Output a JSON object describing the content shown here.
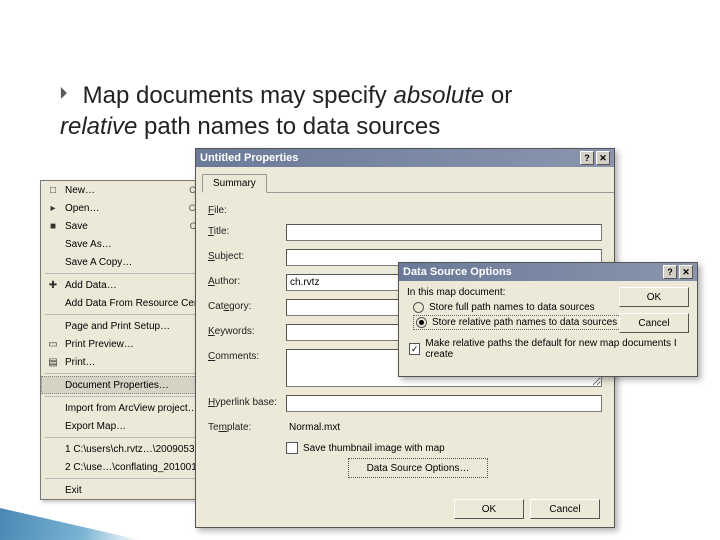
{
  "heading": {
    "pre": "Map documents may specify ",
    "em1": "absolute",
    "mid": " or ",
    "em2": "relative",
    "post": " path names to data sources"
  },
  "filemenu": {
    "items": [
      {
        "icon": "□",
        "label": "New…",
        "shortcut": "Ctrl+N"
      },
      {
        "icon": "▸",
        "label": "Open…",
        "shortcut": "Ctrl+O"
      },
      {
        "icon": "■",
        "label": "Save",
        "shortcut": "Ctrl+S"
      },
      {
        "icon": "",
        "label": "Save As…",
        "shortcut": ""
      },
      {
        "icon": "",
        "label": "Save A Copy…",
        "shortcut": ""
      },
      {
        "sep": true
      },
      {
        "icon": "✚",
        "label": "Add Data…",
        "shortcut": ""
      },
      {
        "icon": "",
        "label": "Add Data From Resource Center…",
        "shortcut": ""
      },
      {
        "sep": true
      },
      {
        "icon": "",
        "label": "Page and Print Setup…",
        "shortcut": ""
      },
      {
        "icon": "▭",
        "label": "Print Preview…",
        "shortcut": ""
      },
      {
        "icon": "▤",
        "label": "Print…",
        "shortcut": ""
      },
      {
        "sep": true
      },
      {
        "icon": "",
        "label": "Document Properties…",
        "shortcut": "",
        "hl": true
      },
      {
        "sep": true
      },
      {
        "icon": "",
        "label": "Import from ArcView project…",
        "shortcut": ""
      },
      {
        "icon": "",
        "label": "Export Map…",
        "shortcut": ""
      },
      {
        "sep": true
      },
      {
        "icon": "",
        "label": "1 C:\\users\\ch.rvtz…\\20090538.mxd",
        "shortcut": ""
      },
      {
        "icon": "",
        "label": "2 C:\\use…\\conflating_20100123.mxd",
        "shortcut": ""
      },
      {
        "sep": true
      },
      {
        "icon": "",
        "label": "Exit",
        "shortcut": ""
      }
    ]
  },
  "props": {
    "title": "Untitled Properties",
    "tab": "Summary",
    "fields": {
      "file": {
        "label": "File:",
        "value": ""
      },
      "title": {
        "label": "Title:",
        "value": ""
      },
      "subject": {
        "label": "Subject:",
        "value": ""
      },
      "author": {
        "label": "Author:",
        "value": "ch.rvtz"
      },
      "category": {
        "label": "Category:",
        "value": ""
      },
      "keywords": {
        "label": "Keywords:",
        "value": ""
      },
      "comments": {
        "label": "Comments:",
        "value": ""
      },
      "hyperlinkbase": {
        "label": "Hyperlink base:",
        "value": ""
      },
      "template": {
        "label": "Template:",
        "value": "Normal.mxt"
      }
    },
    "savethumb_label": "Save thumbnail image with map",
    "dso_button": "Data Source Options…",
    "ok": "OK",
    "cancel": "Cancel"
  },
  "dso": {
    "title": "Data Source Options",
    "prompt": "In this map document:",
    "opt_full": "Store full path names to data sources",
    "opt_rel": "Store relative path names to data sources",
    "make_default": "Make relative paths the default for new map documents I create",
    "ok": "OK",
    "cancel": "Cancel"
  }
}
